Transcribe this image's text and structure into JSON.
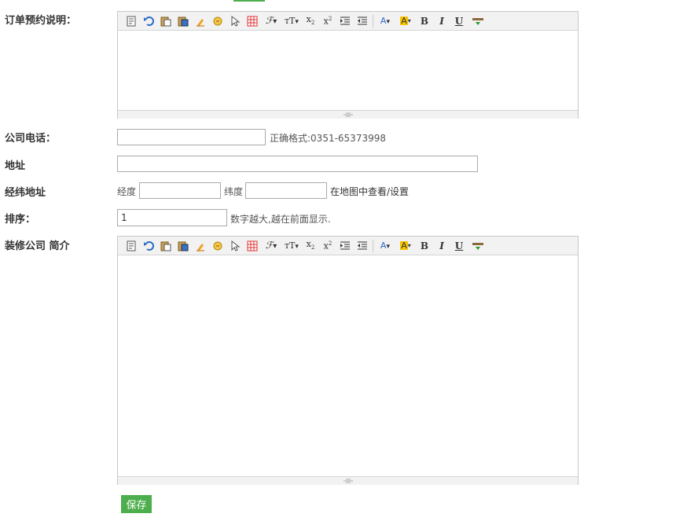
{
  "form": {
    "order_note_label": "订单预约说明：",
    "phone_label": "公司电话：",
    "phone_value": "",
    "phone_hint": "正确格式:0351-65373998",
    "address_label": "地址",
    "address_value": "",
    "coords_label": "经纬地址",
    "lng_label": "经度",
    "lng_value": "",
    "lat_label": "纬度",
    "lat_value": "",
    "map_link": "在地图中查看/设置",
    "sort_label": "排序：",
    "sort_value": "1",
    "sort_hint": "数字越大,越在前面显示.",
    "intro_label": "装修公司 简介",
    "save_label": "保存"
  },
  "toolbar_icons": [
    "source-icon",
    "undo-icon",
    "paste-icon",
    "paste-word-icon",
    "clear-format-icon",
    "template-icon",
    "select-all-icon",
    "table-icon",
    "font-family-icon",
    "font-size-icon",
    "subscript-icon",
    "superscript-icon",
    "indent-icon",
    "outdent-icon",
    "font-color-icon",
    "highlight-icon",
    "bold-icon",
    "italic-icon",
    "underline-icon",
    "more-icon"
  ],
  "colors": {
    "accent": "#4cae4c",
    "highlight": "#f5c400",
    "font_color": "#2a6cc8"
  }
}
